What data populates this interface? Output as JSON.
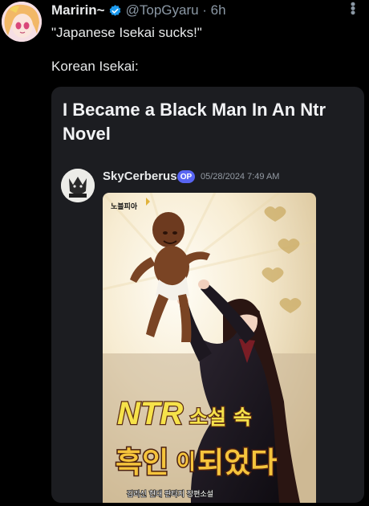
{
  "tweet": {
    "display_name": "Maririn~",
    "handle_time": "@TopGyaru · 6h",
    "text": "\"Japanese Isekai sucks!\"\n\nKorean Isekai:",
    "more_icon": "more-dots-icon",
    "verified_color": "#1d9bf0"
  },
  "card": {
    "title": "I Became a Black Man In An Ntr Novel",
    "author": "SkyCerberus",
    "op_badge": "OP",
    "date": "05/28/2024 7:49 AM",
    "cover": {
      "publisher_logo": "노블피아",
      "title_line_1_latin": "NTR",
      "title_line_1_korean": "소설 속",
      "title_line_2_a": "흑인",
      "title_line_2_b": "이",
      "title_line_2_c": "되었다",
      "credit": "김리신 현대 판타지 장편소설"
    }
  },
  "colors": {
    "background": "#000000",
    "card_bg": "#1c1d21",
    "badge": "#5865f2",
    "muted": "#8b98a5"
  }
}
